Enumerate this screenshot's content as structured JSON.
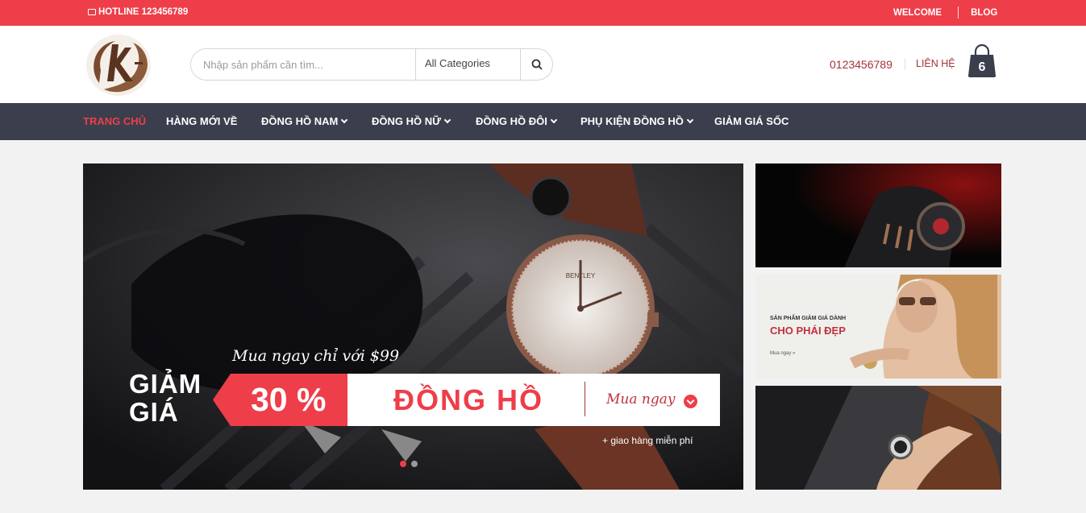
{
  "topbar": {
    "hotline": "HOTLINE 123456789",
    "welcome": "WELCOME",
    "blog": "BLOG"
  },
  "header": {
    "search_placeholder": "Nhập sản phẩm cần tìm...",
    "category": "All Categories",
    "phone": "0123456789",
    "contact": "LIÊN HỆ",
    "cart_count": "6"
  },
  "nav": {
    "items": [
      {
        "label": "TRANG CHỦ",
        "active": true
      },
      {
        "label": "HÀNG MỚI VỀ"
      },
      {
        "label": "ĐỒNG HỒ NAM"
      },
      {
        "label": "ĐỒNG HỒ NỮ"
      },
      {
        "label": "ĐỒNG HỒ ĐÔI"
      },
      {
        "label": "PHỤ KIỆN ĐỒNG HỒ"
      },
      {
        "label": "GIẢM GIÁ SỐC"
      }
    ]
  },
  "banner": {
    "subtitle": "Mua ngay chỉ với $99",
    "giam_line1": "GIẢM",
    "giam_line2": "GIÁ",
    "percent": "30 %",
    "product": "ĐỒNG HỒ",
    "cta": "Mua ngay",
    "shipping": "+ giao hàng miễn phí",
    "watch_brand": "BENTLEY"
  },
  "side_banner_2": {
    "small": "SẢN PHẨM GIẢM GIÁ DÀNH",
    "big": "CHO PHÁI ĐẸP",
    "link": "Mua ngay »"
  },
  "colors": {
    "accent": "#ee3e49",
    "nav_bg": "#3a3e4d",
    "dark_red": "#a23339"
  }
}
